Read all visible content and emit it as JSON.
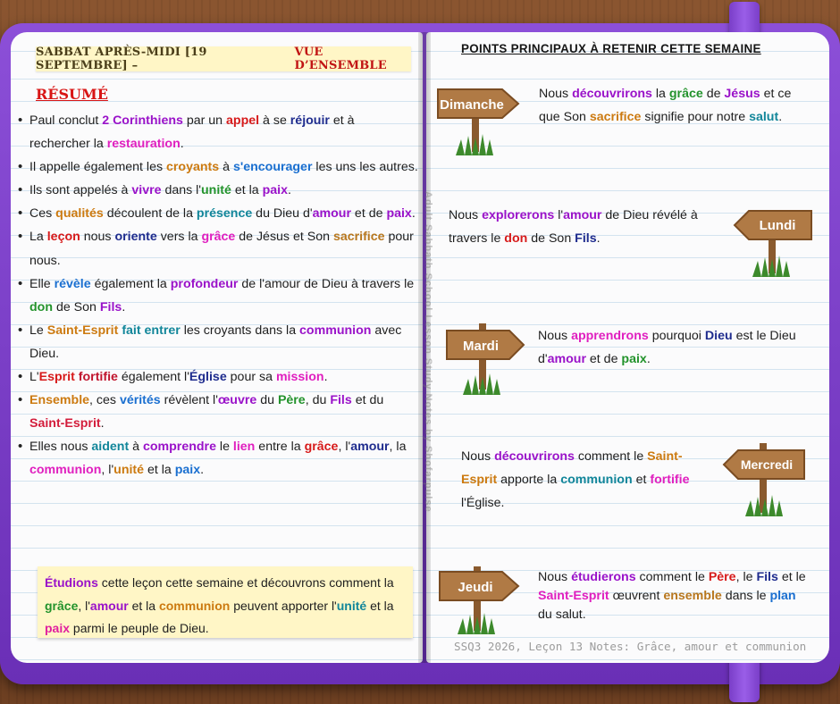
{
  "left_page": {
    "title_main": "SABBAT APRÈS-MIDI [19 SEPTEMBRE] – ",
    "title_highlight": "VUE D’ENSEMBLE",
    "resume_heading": "RÉSUMÉ",
    "bullets": [
      [
        [
          "Paul conclut ",
          ""
        ],
        [
          "2 Corinthiens",
          "c-purple"
        ],
        [
          " par un ",
          ""
        ],
        [
          "appel",
          "c-red"
        ],
        [
          " à se ",
          ""
        ],
        [
          "réjouir",
          "c-navy"
        ],
        [
          " et à rechercher la ",
          ""
        ],
        [
          "restauration",
          "c-magenta"
        ],
        [
          ".",
          ""
        ]
      ],
      [
        [
          "Il appelle également les ",
          ""
        ],
        [
          "croyants",
          "c-orange"
        ],
        [
          " à ",
          ""
        ],
        [
          "s'encourager",
          "c-blue"
        ],
        [
          " les uns les autres.",
          ""
        ]
      ],
      [
        [
          "Ils sont appelés à ",
          ""
        ],
        [
          "vivre",
          "c-purple"
        ],
        [
          " dans l'",
          ""
        ],
        [
          "unité",
          "c-green"
        ],
        [
          " et la ",
          ""
        ],
        [
          "paix",
          "c-purple"
        ],
        [
          ".",
          ""
        ]
      ],
      [
        [
          "Ces ",
          ""
        ],
        [
          "qualités",
          "c-orange"
        ],
        [
          " découlent de la ",
          ""
        ],
        [
          "présence",
          "c-teal"
        ],
        [
          " du Dieu d'",
          ""
        ],
        [
          "amour",
          "c-purple"
        ],
        [
          " et de ",
          ""
        ],
        [
          "paix",
          "c-purple"
        ],
        [
          ".",
          ""
        ]
      ],
      [
        [
          "La ",
          ""
        ],
        [
          "leçon",
          "c-red"
        ],
        [
          " nous ",
          ""
        ],
        [
          "oriente",
          "c-navy"
        ],
        [
          " vers la ",
          ""
        ],
        [
          "grâce",
          "c-magenta"
        ],
        [
          " de Jésus et Son ",
          ""
        ],
        [
          "sacrifice",
          "c-brown"
        ],
        [
          " pour nous.",
          ""
        ]
      ],
      [
        [
          "Elle ",
          ""
        ],
        [
          "révèle",
          "c-blue"
        ],
        [
          " également la ",
          ""
        ],
        [
          "profondeur",
          "c-purple"
        ],
        [
          " de l'amour de Dieu à travers le ",
          ""
        ],
        [
          "don",
          "c-green"
        ],
        [
          " de Son ",
          ""
        ],
        [
          "Fils",
          "c-purple"
        ],
        [
          ".",
          ""
        ]
      ],
      [
        [
          "Le ",
          ""
        ],
        [
          "Saint-Esprit",
          "c-orange"
        ],
        [
          " ",
          ""
        ],
        [
          "fait entrer",
          "c-teal"
        ],
        [
          " les croyants dans la ",
          ""
        ],
        [
          "communion",
          "c-purple"
        ],
        [
          " avec Dieu.",
          ""
        ]
      ],
      [
        [
          "L'",
          ""
        ],
        [
          "Esprit",
          "c-red"
        ],
        [
          " ",
          ""
        ],
        [
          "fortifie",
          "c-darkred"
        ],
        [
          " également l'",
          ""
        ],
        [
          "Église",
          "c-navy"
        ],
        [
          " pour sa ",
          ""
        ],
        [
          "mission",
          "c-magenta"
        ],
        [
          ".",
          ""
        ]
      ],
      [
        [
          "Ensemble",
          "c-orange"
        ],
        [
          ", ces ",
          ""
        ],
        [
          "vérités",
          "c-blue"
        ],
        [
          " révèlent l'",
          ""
        ],
        [
          "œuvre",
          "c-purple"
        ],
        [
          " du ",
          ""
        ],
        [
          "Père",
          "c-green"
        ],
        [
          ", du ",
          ""
        ],
        [
          "Fils",
          "c-purple"
        ],
        [
          " et du ",
          ""
        ],
        [
          "Saint-Esprit",
          "c-crimson"
        ],
        [
          ".",
          ""
        ]
      ],
      [
        [
          "Elles nous ",
          ""
        ],
        [
          "aident",
          "c-teal"
        ],
        [
          " à ",
          ""
        ],
        [
          "comprendre",
          "c-purple"
        ],
        [
          " le ",
          ""
        ],
        [
          "lien",
          "c-magenta"
        ],
        [
          " entre la ",
          ""
        ],
        [
          "grâce",
          "c-red"
        ],
        [
          ", l'",
          ""
        ],
        [
          "amour",
          "c-navy"
        ],
        [
          ", la ",
          ""
        ],
        [
          "communion",
          "c-magenta"
        ],
        [
          ", l'",
          ""
        ],
        [
          "unité",
          "c-orange"
        ],
        [
          " et la ",
          ""
        ],
        [
          "paix",
          "c-blue"
        ],
        [
          ".",
          ""
        ]
      ]
    ],
    "note": [
      [
        "Étudions",
        "c-purple"
      ],
      [
        " cette leçon cette semaine et découvrons comment la ",
        ""
      ],
      [
        "grâce",
        "c-green"
      ],
      [
        ", l'",
        ""
      ],
      [
        "amour",
        "c-purple"
      ],
      [
        " et la ",
        ""
      ],
      [
        "communion",
        "c-orange"
      ],
      [
        " peuvent apporter l'",
        ""
      ],
      [
        "unité",
        "c-teal"
      ],
      [
        " et la ",
        ""
      ],
      [
        "paix",
        "c-pink"
      ],
      [
        " parmi le peuple de Dieu.",
        ""
      ]
    ],
    "vertical_credit": "Adult Sabbath School Lesson Study Notes by Shofarpulse"
  },
  "right_page": {
    "title": "POINTS PRINCIPAUX À RETENIR CETTE SEMAINE",
    "days": [
      {
        "label": "Dimanche",
        "text": [
          [
            "Nous ",
            ""
          ],
          [
            "découvrirons",
            "c-purple"
          ],
          [
            " la ",
            ""
          ],
          [
            "grâce",
            "c-green"
          ],
          [
            " de ",
            ""
          ],
          [
            "Jésus",
            "c-purple"
          ],
          [
            " et ce que Son ",
            ""
          ],
          [
            "sacrifice",
            "c-orange"
          ],
          [
            " signifie pour notre ",
            ""
          ],
          [
            "salut",
            "c-teal"
          ],
          [
            ".",
            ""
          ]
        ]
      },
      {
        "label": "Lundi",
        "text": [
          [
            "Nous ",
            ""
          ],
          [
            "explorerons",
            "c-purple"
          ],
          [
            " l'",
            ""
          ],
          [
            "amour",
            "c-purple"
          ],
          [
            " de Dieu révélé à travers le ",
            ""
          ],
          [
            "don",
            "c-red"
          ],
          [
            " de Son ",
            ""
          ],
          [
            "Fils",
            "c-navy"
          ],
          [
            ".",
            ""
          ]
        ]
      },
      {
        "label": "Mardi",
        "text": [
          [
            "Nous ",
            ""
          ],
          [
            "apprendrons",
            "c-magenta"
          ],
          [
            " pourquoi ",
            ""
          ],
          [
            "Dieu",
            "c-navy"
          ],
          [
            " est le Dieu d'",
            ""
          ],
          [
            "amour",
            "c-purple"
          ],
          [
            " et de ",
            ""
          ],
          [
            "paix",
            "c-green"
          ],
          [
            ".",
            ""
          ]
        ]
      },
      {
        "label": "Mercredi",
        "text": [
          [
            "Nous ",
            ""
          ],
          [
            "découvrirons",
            "c-purple"
          ],
          [
            " comment le ",
            ""
          ],
          [
            "Saint-Esprit",
            "c-orange"
          ],
          [
            " apporte la ",
            ""
          ],
          [
            "communion",
            "c-teal"
          ],
          [
            " et ",
            ""
          ],
          [
            "fortifie",
            "c-magenta"
          ],
          [
            " l'Église.",
            ""
          ]
        ]
      },
      {
        "label": "Jeudi",
        "text": [
          [
            "Nous ",
            ""
          ],
          [
            "étudierons",
            "c-purple"
          ],
          [
            " comment le ",
            ""
          ],
          [
            "Père",
            "c-red"
          ],
          [
            ", le ",
            ""
          ],
          [
            "Fils",
            "c-navy"
          ],
          [
            " et le ",
            ""
          ],
          [
            "Saint-Esprit",
            "c-magenta"
          ],
          [
            " œuvrent ",
            ""
          ],
          [
            "ensemble",
            "c-brown"
          ],
          [
            " dans le ",
            ""
          ],
          [
            "plan",
            "c-blue"
          ],
          [
            " du salut.",
            ""
          ]
        ]
      }
    ],
    "footer": "SSQ3 2026, Leçon 13 Notes: Grâce, amour et communion"
  },
  "colors": {
    "cover": "#7b3fd0",
    "note_background": "#fff6c6",
    "sign_wood": "#b07a45",
    "grass": "#3d8a2c"
  },
  "icons": [
    "wooden-signpost-icon",
    "grass-tuft-icon"
  ]
}
